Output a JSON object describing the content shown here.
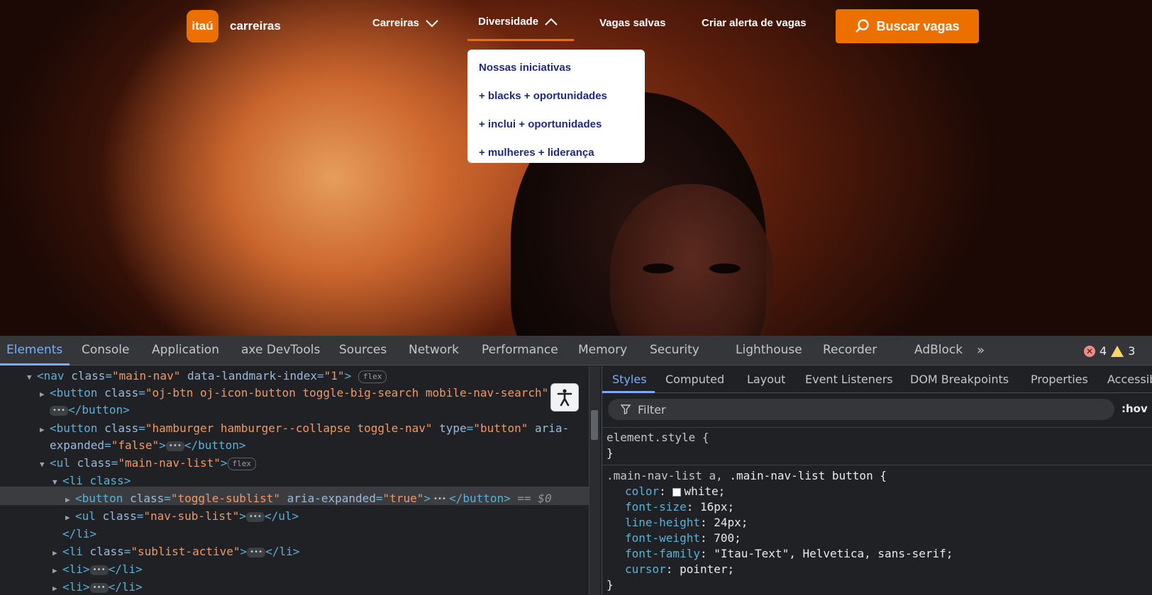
{
  "site": {
    "logo_text": "itaú",
    "brand": "carreiras",
    "nav": {
      "carreiras": "Carreiras",
      "diversidade": "Diversidade",
      "vagas_salvas": "Vagas salvas",
      "criar_alerta": "Criar alerta de vagas",
      "buscar": "Buscar vagas"
    },
    "dropdown": [
      "Nossas iniciativas",
      "+ blacks + oportunidades",
      "+ inclui + oportunidades",
      "+ mulheres + liderança"
    ],
    "colors": {
      "accent": "#ec7000",
      "dropdown_text": "#1f2a7a"
    }
  },
  "devtools": {
    "tabs": [
      "Elements",
      "Console",
      "Application",
      "axe DevTools",
      "Sources",
      "Network",
      "Performance",
      "Memory",
      "Security",
      "Lighthouse",
      "Recorder",
      "AdBlock"
    ],
    "more": "»",
    "errors": "4",
    "warnings": "3",
    "dom": {
      "nav_tag": "nav",
      "nav_class": "main-nav",
      "nav_attr2": "data-landmark-index",
      "nav_attr2_val": "1",
      "flex": "flex",
      "btn1_class": "oj-btn oj-icon-button toggle-big-search mobile-nav-search",
      "btn_close": "</button>",
      "btn2_class": "hamburger hamburger--collapse toggle-nav",
      "btn2_type": "button",
      "btn2_aria": "aria-",
      "btn2_aria_cont": "expanded",
      "btn2_aria_val": "false",
      "ul_class": "main-nav-list",
      "li_open": "<li class>",
      "btn3_class": "toggle-sublist",
      "btn3_aria": "aria-expanded",
      "btn3_aria_val": "true",
      "selected_marker": "== $0",
      "ul2_class": "nav-sub-list",
      "ul_close": "</ul>",
      "li_close": "</li>",
      "li2_class": "sublist-active",
      "li_plain": "<li>"
    },
    "styles_tabs": [
      "Styles",
      "Computed",
      "Layout",
      "Event Listeners",
      "DOM Breakpoints",
      "Properties",
      "Accessibility"
    ],
    "filter_placeholder": "Filter",
    "hov": ":hov",
    "element_style": "element.style {",
    "close_brace": "}",
    "rule_selector_1": ".main-nav-list a,",
    "rule_selector_2": ".main-nav-list button {",
    "props": [
      {
        "name": "color",
        "value": "white;"
      },
      {
        "name": "font-size",
        "value": "16px;"
      },
      {
        "name": "line-height",
        "value": "24px;"
      },
      {
        "name": "font-weight",
        "value": "700;"
      },
      {
        "name": "font-family",
        "value": "\"Itau-Text\", Helvetica, sans-serif;"
      },
      {
        "name": "cursor",
        "value": "pointer;"
      }
    ]
  }
}
